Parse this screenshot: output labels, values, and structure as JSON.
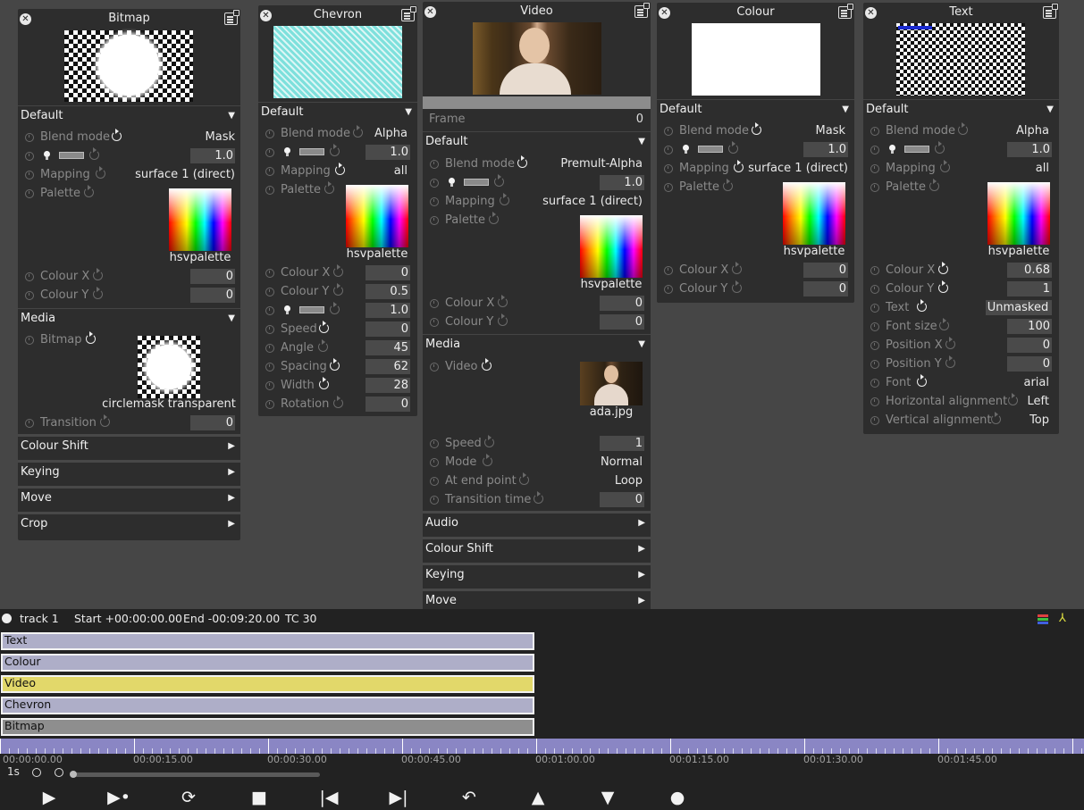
{
  "bitmap_panel": {
    "title": "Bitmap",
    "default_label": "Default",
    "blend_mode_label": "Blend mode",
    "blend_mode_value": "Mask",
    "opacity_value": "1.0",
    "mapping_label": "Mapping",
    "mapping_value": "surface 1 (direct)",
    "palette_label": "Palette",
    "palette_name": "hsvpalette",
    "colour_x_label": "Colour X",
    "colour_x_value": "0",
    "colour_y_label": "Colour Y",
    "colour_y_value": "0",
    "media_label": "Media",
    "bitmap_label": "Bitmap",
    "bitmap_name": "circlemask transparent",
    "transition_label": "Transition",
    "transition_value": "0",
    "sections": [
      "Colour Shift",
      "Keying",
      "Move",
      "Crop"
    ]
  },
  "chevron_panel": {
    "title": "Chevron",
    "default_label": "Default",
    "blend_mode_label": "Blend mode",
    "blend_mode_value": "Alpha",
    "opacity_value": "1.0",
    "mapping_label": "Mapping",
    "mapping_value": "all",
    "palette_label": "Palette",
    "palette_name": "hsvpalette",
    "colour_x_label": "Colour X",
    "colour_x_value": "0",
    "colour_y_label": "Colour Y",
    "colour_y_value": "0.5",
    "opacity2_value": "1.0",
    "speed_label": "Speed",
    "speed_value": "0",
    "angle_label": "Angle",
    "angle_value": "45",
    "spacing_label": "Spacing",
    "spacing_value": "62",
    "width_label": "Width",
    "width_value": "28",
    "rotation_label": "Rotation",
    "rotation_value": "0"
  },
  "video_panel": {
    "title": "Video",
    "frame_label": "Frame",
    "frame_value": "0",
    "default_label": "Default",
    "blend_mode_label": "Blend mode",
    "blend_mode_value": "Premult-Alpha",
    "opacity_value": "1.0",
    "mapping_label": "Mapping",
    "mapping_value": "surface 1 (direct)",
    "palette_label": "Palette",
    "palette_name": "hsvpalette",
    "colour_x_label": "Colour X",
    "colour_x_value": "0",
    "colour_y_label": "Colour Y",
    "colour_y_value": "0",
    "media_label": "Media",
    "video_label": "Video",
    "video_name": "ada.jpg",
    "speed_label": "Speed",
    "speed_value": "1",
    "mode_label": "Mode",
    "mode_value": "Normal",
    "end_point_label": "At end point",
    "end_point_value": "Loop",
    "transition_time_label": "Transition time",
    "transition_time_value": "0",
    "sections": [
      "Audio",
      "Colour Shift",
      "Keying",
      "Move"
    ]
  },
  "colour_panel": {
    "title": "Colour",
    "default_label": "Default",
    "blend_mode_label": "Blend mode",
    "blend_mode_value": "Mask",
    "opacity_value": "1.0",
    "mapping_label": "Mapping",
    "mapping_value": "surface 1 (direct)",
    "palette_label": "Palette",
    "palette_name": "hsvpalette",
    "colour_x_label": "Colour X",
    "colour_x_value": "0",
    "colour_y_label": "Colour Y",
    "colour_y_value": "0"
  },
  "text_panel": {
    "title": "Text",
    "default_label": "Default",
    "blend_mode_label": "Blend mode",
    "blend_mode_value": "Alpha",
    "opacity_value": "1.0",
    "mapping_label": "Mapping",
    "mapping_value": "all",
    "palette_label": "Palette",
    "palette_name": "hsvpalette",
    "colour_x_label": "Colour X",
    "colour_x_value": "0.68",
    "colour_y_label": "Colour Y",
    "colour_y_value": "1",
    "text_label": "Text",
    "text_value": "Unmasked",
    "font_size_label": "Font size",
    "font_size_value": "100",
    "position_x_label": "Position X",
    "position_x_value": "0",
    "position_y_label": "Position Y",
    "position_y_value": "0",
    "font_label": "Font",
    "font_value": "arial",
    "h_align_label": "Horizontal alignment",
    "h_align_value": "Left",
    "v_align_label": "Vertical alignment",
    "v_align_value": "Top"
  },
  "timeline": {
    "track_name": "track 1",
    "start": "Start +00:00:00.00",
    "end": "End -00:09:20.00",
    "tc": "TC 30",
    "tracks": [
      {
        "label": "Text",
        "color": "#aeaec8"
      },
      {
        "label": "Colour",
        "color": "#aeaec8"
      },
      {
        "label": "Video",
        "color": "#e2d86a"
      },
      {
        "label": "Chevron",
        "color": "#aeaec8"
      },
      {
        "label": "Bitmap",
        "color": "#8e8e8e"
      }
    ],
    "ruler_labels": [
      "00:00:00.00",
      "00:00:15.00",
      "00:00:30.00",
      "00:00:45.00",
      "00:01:00.00",
      "00:01:15.00",
      "00:01:30.00",
      "00:01:45.00"
    ],
    "zoom_unit": "1s"
  },
  "transport": {
    "buttons": [
      "play",
      "play-marker",
      "loop",
      "stop",
      "skip-back",
      "skip-forward",
      "undo",
      "up",
      "down",
      "record"
    ],
    "glyphs": [
      "▶",
      "▶•",
      "⟳",
      "■",
      "|◀",
      "▶|",
      "↶",
      "▲",
      "▼",
      "●"
    ]
  }
}
